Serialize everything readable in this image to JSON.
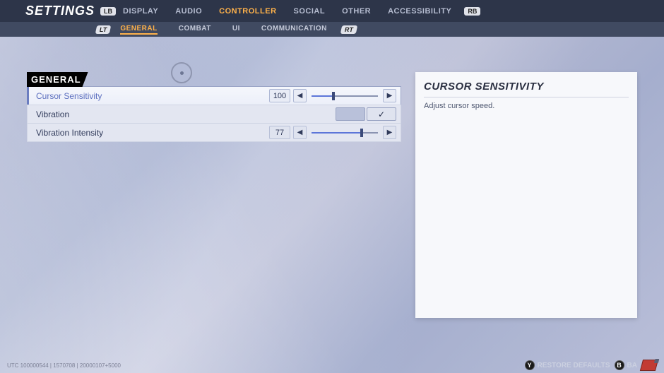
{
  "header": {
    "title": "SETTINGS",
    "bumper_left": "LB",
    "bumper_right": "RB",
    "tabs": [
      {
        "label": "DISPLAY",
        "active": false
      },
      {
        "label": "AUDIO",
        "active": false
      },
      {
        "label": "CONTROLLER",
        "active": true
      },
      {
        "label": "SOCIAL",
        "active": false
      },
      {
        "label": "OTHER",
        "active": false
      },
      {
        "label": "ACCESSIBILITY",
        "active": false
      }
    ]
  },
  "subheader": {
    "trigger_left": "LT",
    "trigger_right": "RT",
    "tabs": [
      {
        "label": "GENERAL",
        "active": true
      },
      {
        "label": "COMBAT",
        "active": false
      },
      {
        "label": "UI",
        "active": false
      },
      {
        "label": "COMMUNICATION",
        "active": false
      }
    ]
  },
  "section": {
    "title": "GENERAL"
  },
  "settings": {
    "cursor_sensitivity": {
      "label": "Cursor Sensitivity",
      "value": "100",
      "fill_pct": 33
    },
    "vibration": {
      "label": "Vibration",
      "checked": true
    },
    "vibration_intensity": {
      "label": "Vibration Intensity",
      "value": "77",
      "fill_pct": 76
    }
  },
  "info": {
    "title": "CURSOR SENSITIVITY",
    "description": "Adjust cursor speed."
  },
  "footer": {
    "version": "UTC 100000544 | 1570708 | 20000107+5000",
    "restore_btn_icon": "Y",
    "restore_label": "RESTORE DEFAULTS",
    "back_btn_icon": "B",
    "back_label": "BA"
  },
  "glyphs": {
    "left": "◀",
    "right": "▶",
    "check": "✓"
  }
}
